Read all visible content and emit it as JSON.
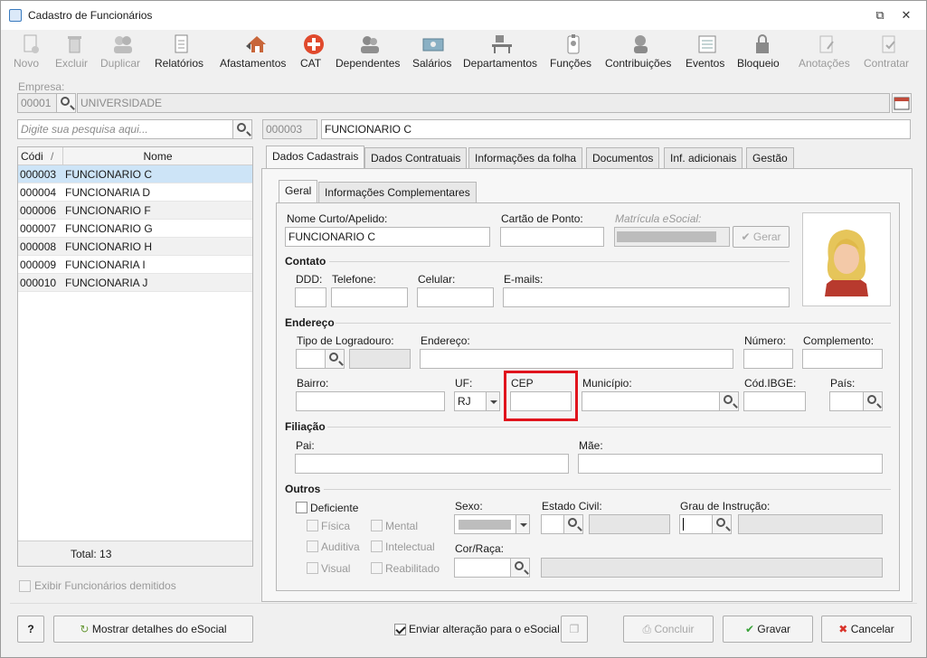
{
  "window": {
    "title": "Cadastro de Funcionários"
  },
  "toolbar": [
    {
      "label": "Novo",
      "icon": "new-doc-icon",
      "enabled": false
    },
    {
      "label": "Excluir",
      "icon": "trash-icon",
      "enabled": false
    },
    {
      "label": "Duplicar",
      "icon": "duplicate-users-icon",
      "enabled": false
    },
    {
      "label": "Relatórios",
      "icon": "report-icon",
      "enabled": true
    },
    {
      "label": "Afastamentos",
      "icon": "home-arrow-icon",
      "enabled": true
    },
    {
      "label": "CAT",
      "icon": "red-cross-icon",
      "enabled": true
    },
    {
      "label": "Dependentes",
      "icon": "users-icon",
      "enabled": true
    },
    {
      "label": "Salários",
      "icon": "money-icon",
      "enabled": true
    },
    {
      "label": "Departamentos",
      "icon": "desk-icon",
      "enabled": true
    },
    {
      "label": "Funções",
      "icon": "badge-icon",
      "enabled": true
    },
    {
      "label": "Contribuições",
      "icon": "people-icon",
      "enabled": true
    },
    {
      "label": "Eventos",
      "icon": "list-icon",
      "enabled": true
    },
    {
      "label": "Bloqueio",
      "icon": "lock-icon",
      "enabled": true
    },
    {
      "label": "Anotações",
      "icon": "note-icon",
      "enabled": false
    },
    {
      "label": "Contratar",
      "icon": "contract-icon",
      "enabled": false
    }
  ],
  "empresa": {
    "label": "Empresa:",
    "code": "00001",
    "name": "UNIVERSIDADE"
  },
  "search": {
    "placeholder": "Digite sua pesquisa aqui..."
  },
  "employee": {
    "code": "000003",
    "name": "FUNCIONARIO C"
  },
  "grid": {
    "headers": {
      "code": "Códi",
      "name": "Nome"
    },
    "sort_mark": "/",
    "rows": [
      {
        "code": "000003",
        "name": "FUNCIONARIO C"
      },
      {
        "code": "000004",
        "name": "FUNCIONARIA D"
      },
      {
        "code": "000006",
        "name": "FUNCIONARIO F"
      },
      {
        "code": "000007",
        "name": "FUNCIONARIO G"
      },
      {
        "code": "000008",
        "name": "FUNCIONARIO H"
      },
      {
        "code": "000009",
        "name": "FUNCIONARIA I"
      },
      {
        "code": "000010",
        "name": "FUNCIONARIA J"
      }
    ],
    "total": "Total: 13"
  },
  "show_dismissed": "Exibir Funcionários demitidos",
  "main_tabs": [
    "Dados Cadastrais",
    "Dados Contratuais",
    "Informações da folha",
    "Documentos",
    "Inf. adicionais",
    "Gestão"
  ],
  "sub_tabs": [
    "Geral",
    "Informações Complementares"
  ],
  "form": {
    "nome_curto": {
      "label": "Nome Curto/Apelido:",
      "value": "FUNCIONARIO C"
    },
    "cartao": {
      "label": "Cartão de Ponto:"
    },
    "matricula": {
      "label": "Matrícula eSocial:",
      "button": "Gerar"
    },
    "contato": {
      "title": "Contato",
      "ddd": "DDD:",
      "telefone": "Telefone:",
      "celular": "Celular:",
      "emails": "E-mails:"
    },
    "endereco": {
      "title": "Endereço",
      "tipo": "Tipo de Logradouro:",
      "endereco": "Endereço:",
      "numero": "Número:",
      "complemento": "Complemento:",
      "bairro": "Bairro:",
      "uf": "UF:",
      "uf_value": "RJ",
      "cep": "CEP",
      "municipio": "Município:",
      "ibge": "Cód.IBGE:",
      "pais": "País:"
    },
    "filiacao": {
      "title": "Filiação",
      "pai": "Pai:",
      "mae": "Mãe:"
    },
    "outros": {
      "title": "Outros",
      "deficiente": "Deficiente",
      "fisica": "Física",
      "mental": "Mental",
      "auditiva": "Auditiva",
      "intelectual": "Intelectual",
      "visual": "Visual",
      "reabilitado": "Reabilitado",
      "sexo": "Sexo:",
      "estado_civil": "Estado Civil:",
      "grau": "Grau de Instrução:",
      "cor": "Cor/Raça:"
    }
  },
  "bottom": {
    "help": "?",
    "esocial_details": "Mostrar detalhes do eSocial",
    "send_change": "Enviar alteração para o eSocial",
    "concluir": "Concluir",
    "gravar": "Gravar",
    "cancelar": "Cancelar"
  },
  "colors": {
    "highlight": "#e0141d",
    "selection": "#cde4f7",
    "cancel_x": "#d9342b",
    "save_check": "#3aa33a"
  }
}
